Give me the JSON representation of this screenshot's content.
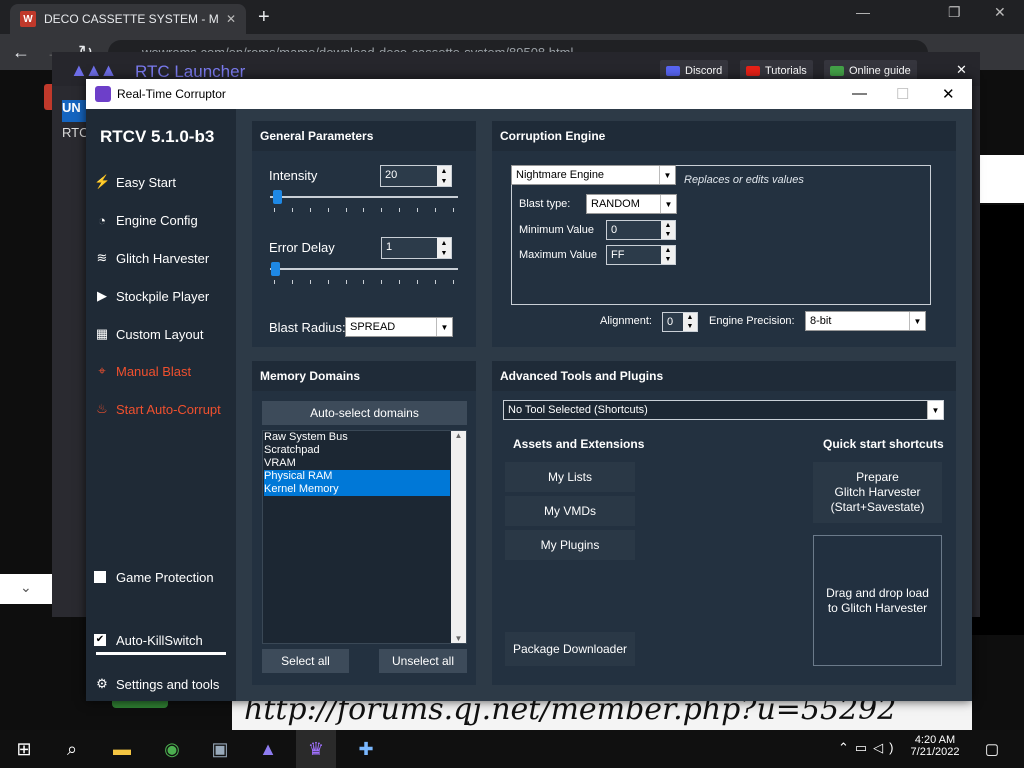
{
  "browser": {
    "tab_title": "DECO CASSETTE SYSTEM - MAM",
    "url": "wowroms.com/en/roms/mame/download-deco-cassette-system/89508.html"
  },
  "webpage": {
    "forum_text": "http://forums.qj.net/member.php?u=55292"
  },
  "launcher": {
    "title": "RTC Launcher",
    "buttons": [
      "Discord",
      "Tutorials",
      "Online guide"
    ],
    "left_badge": "UN",
    "left_text": "RTC"
  },
  "window": {
    "title": "Real-Time Corruptor",
    "version": "RTCV 5.1.0-b3"
  },
  "sidebar": {
    "items": [
      {
        "label": "Easy Start",
        "icon": "wand-icon"
      },
      {
        "label": "Engine Config",
        "icon": "gauge-icon"
      },
      {
        "label": "Glitch Harvester",
        "icon": "layers-icon"
      },
      {
        "label": "Stockpile Player",
        "icon": "play-icon"
      },
      {
        "label": "Custom Layout",
        "icon": "grid-icon"
      },
      {
        "label": "Manual Blast",
        "icon": "crosshair-icon"
      },
      {
        "label": "Start Auto-Corrupt",
        "icon": "fire-icon"
      }
    ],
    "game_protection": "Game Protection",
    "game_protection_checked": false,
    "auto_killswitch": "Auto-KillSwitch",
    "auto_killswitch_checked": true,
    "settings": "Settings and tools"
  },
  "general_parameters": {
    "header": "General Parameters",
    "intensity_label": "Intensity",
    "intensity_value": "20",
    "error_delay_label": "Error Delay",
    "error_delay_value": "1",
    "blast_radius_label": "Blast Radius:",
    "blast_radius_value": "SPREAD"
  },
  "corruption_engine": {
    "header": "Corruption Engine",
    "engine": "Nightmare Engine",
    "engine_desc": "Replaces or edits values",
    "blast_type_label": "Blast type:",
    "blast_type_value": "RANDOM",
    "min_label": "Minimum Value",
    "min_value": "0",
    "max_label": "Maximum Value",
    "max_value": "FF",
    "alignment_label": "Alignment:",
    "alignment_value": "0",
    "precision_label": "Engine Precision:",
    "precision_value": "8-bit"
  },
  "memory_domains": {
    "header": "Memory Domains",
    "auto_select": "Auto-select domains",
    "domains": [
      {
        "name": "Raw System Bus",
        "selected": false
      },
      {
        "name": "Scratchpad",
        "selected": false
      },
      {
        "name": "VRAM",
        "selected": false
      },
      {
        "name": "Physical RAM",
        "selected": true
      },
      {
        "name": "Kernel Memory",
        "selected": true
      }
    ],
    "select_all": "Select all",
    "unselect_all": "Unselect all"
  },
  "advanced_tools": {
    "header": "Advanced Tools and Plugins",
    "tool_select": "No Tool Selected (Shortcuts)",
    "assets_header": "Assets and Extensions",
    "quick_header": "Quick start shortcuts",
    "my_lists": "My Lists",
    "my_vmds": "My VMDs",
    "my_plugins": "My Plugins",
    "package_downloader": "Package Downloader",
    "prepare_line1": "Prepare",
    "prepare_line2": "Glitch Harvester",
    "prepare_line3": "(Start+Savestate)",
    "drag_line1": "Drag and drop load",
    "drag_line2": "to Glitch Harvester"
  },
  "taskbar": {
    "time": "4:20 AM",
    "date": "7/21/2022"
  }
}
